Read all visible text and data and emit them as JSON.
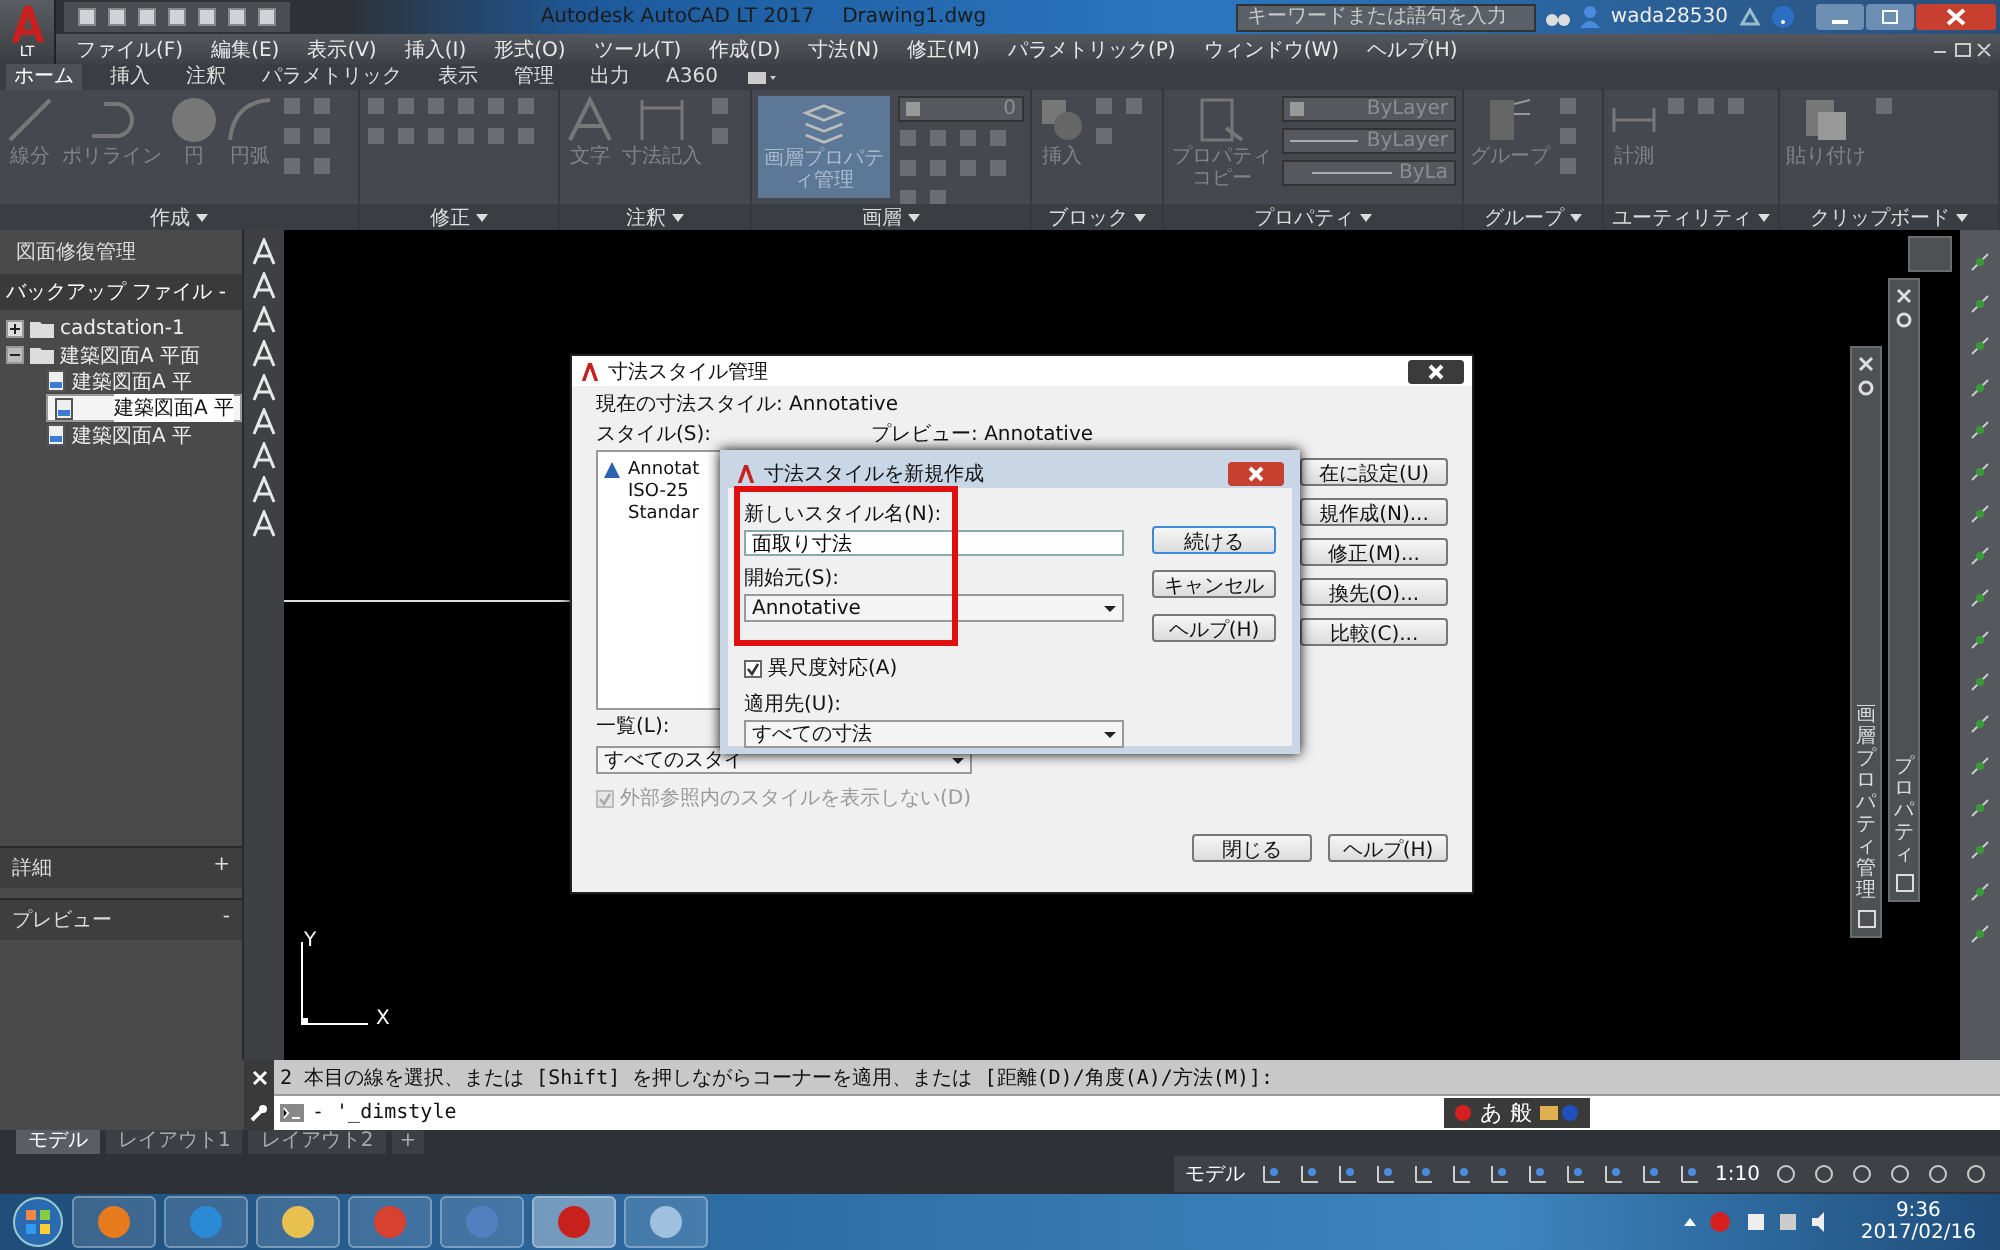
{
  "app_button": {
    "label": "LT"
  },
  "title_bar": {
    "title": "Autodesk AutoCAD LT 2017",
    "document": "Drawing1.dwg",
    "search": {
      "placeholder": "キーワードまたは語句を入力"
    },
    "user": "wada28530"
  },
  "menu_bar": [
    "ファイル(F)",
    "編集(E)",
    "表示(V)",
    "挿入(I)",
    "形式(O)",
    "ツール(T)",
    "作成(D)",
    "寸法(N)",
    "修正(M)",
    "パラメトリック(P)",
    "ウィンドウ(W)",
    "ヘルプ(H)"
  ],
  "ribbon": {
    "tabs": [
      {
        "label": "ホーム",
        "selected": true
      },
      {
        "label": "挿入",
        "selected": false
      },
      {
        "label": "注釈",
        "selected": false
      },
      {
        "label": "パラメトリック",
        "selected": false
      },
      {
        "label": "表示",
        "selected": false
      },
      {
        "label": "管理",
        "selected": false
      },
      {
        "label": "出力",
        "selected": false
      },
      {
        "label": "A360",
        "selected": false
      }
    ],
    "panels": [
      {
        "title": "作成",
        "tools": [
          {
            "label": "線分",
            "kind": "line"
          },
          {
            "label": "ポリライン",
            "kind": "polyline"
          },
          {
            "label": "円",
            "kind": "circle"
          },
          {
            "label": "円弧",
            "kind": "arc"
          }
        ]
      },
      {
        "title": "修正"
      },
      {
        "title": "注釈",
        "tools": [
          {
            "label": "文字",
            "kind": "text"
          },
          {
            "label": "寸法記入",
            "kind": "dimension"
          }
        ]
      },
      {
        "title": "画層",
        "tools": [
          {
            "label": "画層プロパティ管理",
            "kind": "layers"
          }
        ],
        "layer": "0"
      },
      {
        "title": "ブロック",
        "tools": [
          {
            "label": "挿入",
            "kind": "insert"
          }
        ]
      },
      {
        "title": "プロパティ",
        "tools": [
          {
            "label": "プロパティコピー",
            "kind": "match"
          }
        ],
        "properties": [
          "ByLayer",
          "ByLayer",
          "ByLa"
        ]
      },
      {
        "title": "グループ",
        "tools": [
          {
            "label": "グループ",
            "kind": "group"
          }
        ]
      },
      {
        "title": "ユーティリティ",
        "tools": [
          {
            "label": "計測",
            "kind": "measure"
          }
        ]
      },
      {
        "title": "クリップボード",
        "tools": [
          {
            "label": "貼り付け",
            "kind": "paste"
          }
        ]
      }
    ]
  },
  "recovery_panel": {
    "title": "図面修復管理",
    "section": "バックアップ ファイル -",
    "tree": [
      {
        "label": "cadstation-1",
        "expanded": false,
        "selected": false
      },
      {
        "label": "建築図面A 平面",
        "expanded": true,
        "selected": false,
        "children": [
          {
            "label": "建築図面A 平",
            "selected": false
          },
          {
            "label": "建築図面A 平",
            "selected": true
          },
          {
            "label": "建築図面A 平",
            "selected": false
          }
        ]
      }
    ],
    "details": {
      "label": "詳細",
      "toggle": "+"
    },
    "preview": {
      "label": "プレビュー",
      "toggle": "-"
    }
  },
  "canvas": {
    "axis_x": "X",
    "axis_y": "Y"
  },
  "palettes": [
    {
      "title": "画層プロパティ管理"
    },
    {
      "title": "プロパティ"
    }
  ],
  "dim_style_manager": {
    "title": "寸法スタイル管理",
    "current": "現在の寸法スタイル: Annotative",
    "styles_label": "スタイル(S):",
    "preview_label": "プレビュー: Annotative",
    "styles": [
      {
        "label": "Annotat",
        "annotative": true
      },
      {
        "label": "ISO-25",
        "annotative": false
      },
      {
        "label": "Standar",
        "annotative": false
      }
    ],
    "buttons": [
      "在に設定(U)",
      "規作成(N)...",
      "修正(M)...",
      "換先(O)...",
      "比較(C)..."
    ],
    "list_label": "一覧(L):",
    "list_value": "すべてのスタイ",
    "xref_option": {
      "label": "外部参照内のスタイルを表示しない(D)",
      "checked": true,
      "disabled": true
    },
    "footer_buttons": [
      "閉じる",
      "ヘルプ(H)"
    ]
  },
  "new_style_dialog": {
    "title": "寸法スタイルを新規作成",
    "name_label": "新しいスタイル名(N):",
    "name_value": "面取り寸法",
    "start_label": "開始元(S):",
    "start_value": "Annotative",
    "annotative": {
      "label": "異尺度対応(A)",
      "checked": true
    },
    "apply_label": "適用先(U):",
    "apply_value": "すべての寸法",
    "buttons": [
      {
        "label": "続ける",
        "default": true
      },
      {
        "label": "キャンセル",
        "default": false
      },
      {
        "label": "ヘルプ(H)",
        "default": false
      }
    ]
  },
  "command_line": {
    "history": "2 本目の線を選択、または [Shift] を押しながらコーナーを適用、または [距離(D)/角度(A)/方法(M)]:",
    "input": "- '_dimstyle"
  },
  "ime_bar": {
    "mode": "あ",
    "dictionary": "般"
  },
  "layout_tabs": [
    {
      "label": "モデル",
      "selected": true
    },
    {
      "label": "レイアウト1",
      "selected": false
    },
    {
      "label": "レイアウト2",
      "selected": false
    }
  ],
  "add_layout": "+",
  "status_bar": {
    "space": "モデル",
    "scale": "1:10"
  },
  "taskbar": {
    "time": "9:36",
    "date": "2017/02/16"
  }
}
